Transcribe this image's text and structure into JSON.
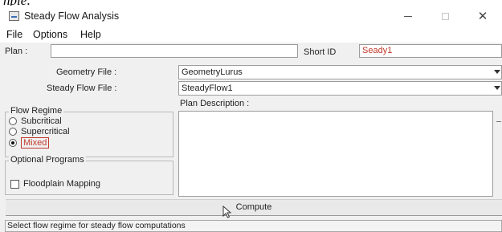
{
  "caption": "nple:",
  "window": {
    "title": "Steady Flow Analysis",
    "buttons": {
      "minimize": "—",
      "maximize": "□",
      "close": "✕"
    }
  },
  "menu": [
    "File",
    "Options",
    "Help"
  ],
  "plan": {
    "label": "Plan :",
    "value": ""
  },
  "short_id": {
    "label": "Short ID",
    "value": "Seady1"
  },
  "geometry_file": {
    "label": "Geometry File :",
    "value": "GeometryLurus"
  },
  "steady_flow_file": {
    "label": "Steady Flow File :",
    "value": "SteadyFlow1"
  },
  "plan_description": {
    "label": "Plan Description :",
    "value": ""
  },
  "flow_regime": {
    "title": "Flow Regime",
    "options": [
      {
        "label": "Subcritical",
        "selected": false
      },
      {
        "label": "Supercritical",
        "selected": false
      },
      {
        "label": "Mixed",
        "selected": true
      }
    ]
  },
  "optional_programs": {
    "title": "Optional Programs",
    "floodplain_mapping": {
      "label": "Floodplain Mapping",
      "checked": false
    }
  },
  "compute_button": "Compute",
  "status_bar": "Select flow regime for steady flow computations",
  "icons": {
    "app": "app-icon",
    "cursor": "mouse-pointer-icon",
    "dropdown": "chevron-down-icon"
  },
  "colors": {
    "accent_red": "#c0392b",
    "window_bg": "#f0f0f0"
  }
}
